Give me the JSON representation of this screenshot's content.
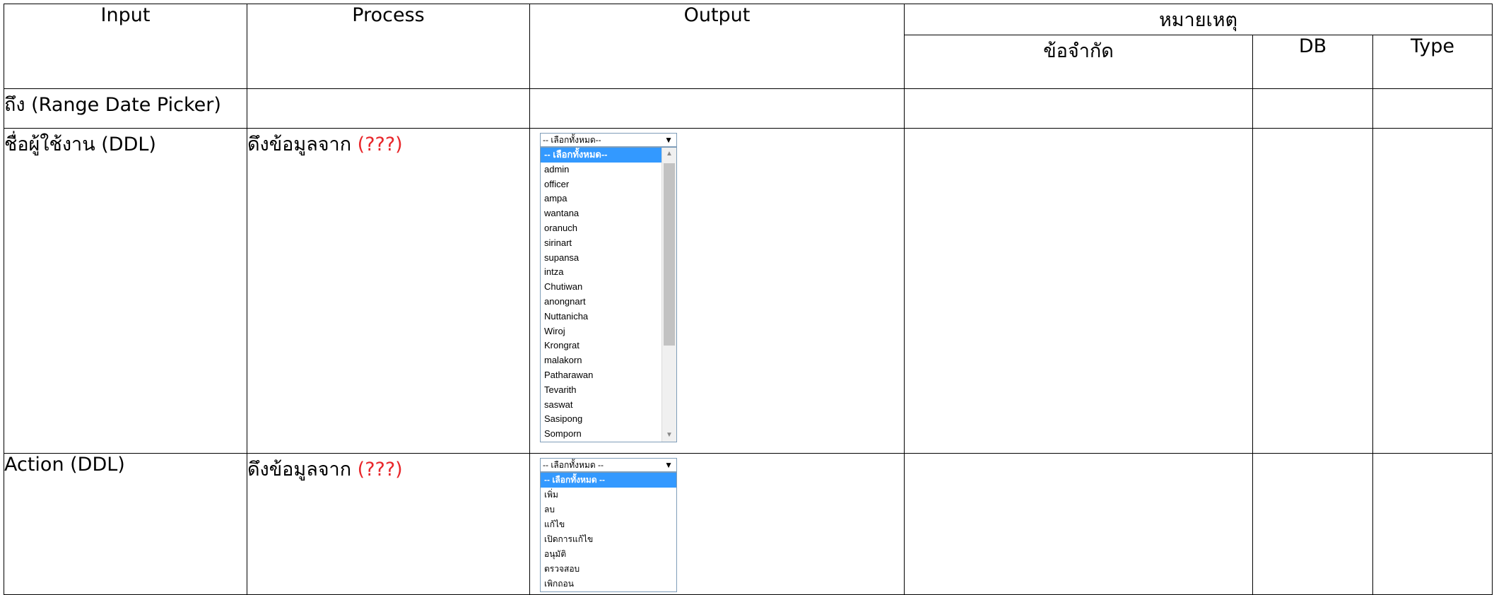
{
  "table": {
    "headers": {
      "input": "Input",
      "process": "Process",
      "output": "Output",
      "remarks": "หมายเหตุ",
      "constraint": "ข้อจำกัด",
      "db": "DB",
      "type": "Type"
    },
    "rows": [
      {
        "input": "ถึง (Range Date Picker)",
        "process": "",
        "process_note": ""
      },
      {
        "input": "ชื่อผู้ใช้งาน (DDL)",
        "process": "ดึงข้อมูลจาก ",
        "process_note": "(???)"
      },
      {
        "input": "Action (DDL)",
        "process": "ดึงข้อมูลจาก ",
        "process_note": "(???)"
      }
    ]
  },
  "user_dropdown": {
    "selected": "-- เลือกทั้งหมด--",
    "options": [
      "-- เลือกทั้งหมด--",
      "admin",
      "officer",
      "ampa",
      "wantana",
      "oranuch",
      "sirinart",
      "supansa",
      "intza",
      "Chutiwan",
      "anongnart",
      "Nuttanicha",
      "Wiroj",
      "Krongrat",
      "malakorn",
      "Patharawan",
      "Tevarith",
      "saswat",
      "Sasipong",
      "Somporn"
    ]
  },
  "action_dropdown": {
    "selected": "-- เลือกทั้งหมด --",
    "options": [
      "-- เลือกทั้งหมด --",
      "เพิ่ม",
      "ลบ",
      "แก้ไข",
      "เปิดการแก้ไข",
      "อนุมัติ",
      "ตรวจสอบ",
      "เพิกถอน"
    ]
  },
  "icons": {
    "arrow": "▼",
    "scroll_up": "▲",
    "scroll_down": "▼"
  },
  "colors": {
    "note_red": "#e8262a",
    "highlight": "#3399ff"
  }
}
